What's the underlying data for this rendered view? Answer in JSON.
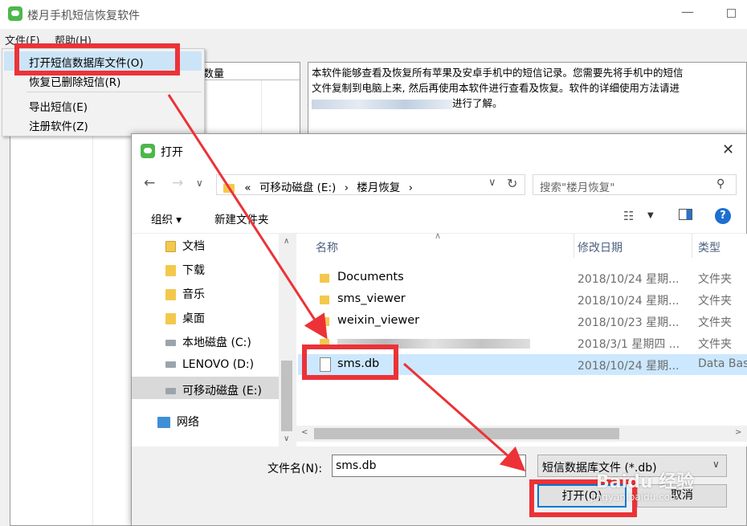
{
  "main_window": {
    "title": "楼月手机短信恢复软件",
    "menu": {
      "file": "文件(F)",
      "help": "帮助(H)"
    },
    "list_header_count": "数量",
    "info_text_line1": "本软件能够查看及恢复所有苹果及安卓手机中的短信记录。您需要先将手机中的短信",
    "info_text_line2": "文件复制到电脑上来, 然后再使用本软件进行查看及恢复。软件的详细使用方法请进",
    "info_text_line3_end": "进行了解。"
  },
  "file_menu": {
    "items": [
      "打开短信数据库文件(O)",
      "恢复已删除短信(R)",
      "导出短信(E)",
      "注册软件(Z)"
    ]
  },
  "dialog": {
    "title": "打开",
    "address": {
      "prefix": "«",
      "drive": "可移动磁盘 (E:)",
      "sep": "›",
      "folder": "楼月恢复",
      "end": "›"
    },
    "search_placeholder": "搜索\"楼月恢复\"",
    "toolbar": {
      "organize": "组织 ▾",
      "new_folder": "新建文件夹"
    },
    "nav_items": [
      "文档",
      "下载",
      "音乐",
      "桌面",
      "本地磁盘 (C:)",
      "LENOVO (D:)",
      "可移动磁盘 (E:)",
      "网络"
    ],
    "columns": {
      "name": "名称",
      "date": "修改日期",
      "type": "类型"
    },
    "files": [
      {
        "name": "Documents",
        "date": "2018/10/24 星期...",
        "type": "文件夹"
      },
      {
        "name": "sms_viewer",
        "date": "2018/10/24 星期...",
        "type": "文件夹"
      },
      {
        "name": "weixin_viewer",
        "date": "2018/10/23 星期...",
        "type": "文件夹"
      },
      {
        "name": "",
        "date": "2018/3/1 星期四 ...",
        "type": "文件夹"
      },
      {
        "name": "sms.db",
        "date": "2018/10/24 星期...",
        "type": "Data Bas"
      }
    ],
    "filename_label": "文件名(N):",
    "filename_value": "sms.db",
    "filter": "短信数据库文件 (*.db)",
    "open_button": "打开(O)",
    "cancel_button": "取消"
  },
  "watermark": {
    "brand": "Baidu 经验",
    "url": "jingyan.baidu.com"
  },
  "colors": {
    "highlight": "#ec3237",
    "selection": "#cce8ff",
    "accent": "#0078d7"
  }
}
